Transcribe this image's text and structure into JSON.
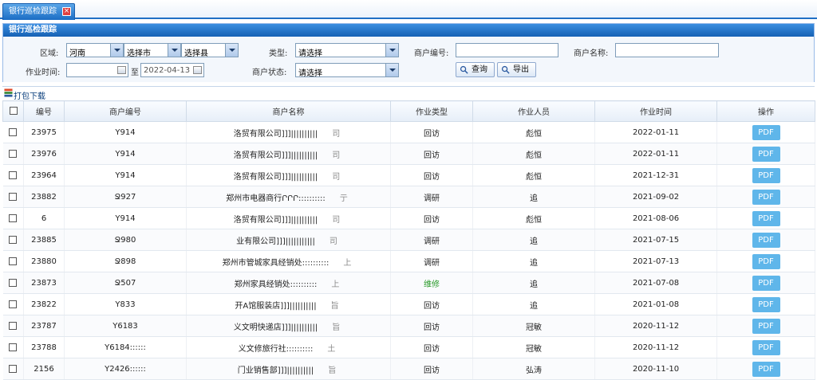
{
  "tab": {
    "title": "银行巡检跟踪"
  },
  "panel": {
    "title": "银行巡检跟踪"
  },
  "filters": {
    "region_label": "区域:",
    "province": "河南",
    "city": "选择市",
    "county": "选择县",
    "type_label": "类型:",
    "type_value": "请选择",
    "merchant_no_label": "商户编号:",
    "merchant_name_label": "商户名称:",
    "time_label": "作业时间:",
    "to_label": "至",
    "end_date": "2022-04-13",
    "status_label": "商户状态:",
    "status_value": "请选择",
    "query_label": "查询",
    "export_label": "导出"
  },
  "toolbar": {
    "download_label": "打包下载"
  },
  "table": {
    "headers": [
      "编号",
      "商户编号",
      "商户名称",
      "作业类型",
      "作业人员",
      "作业时间",
      "操作"
    ],
    "rows": [
      {
        "id": "23975",
        "merchant_no": "Y914",
        "name": "洛贸有限公司]]]||||||||||",
        "code": "司",
        "type": "回访",
        "staff": "彪恒",
        "date": "2022-01-11",
        "action": "PDF"
      },
      {
        "id": "23976",
        "merchant_no": "Y914",
        "name": "洛贸有限公司]]]||||||||||",
        "code": "司",
        "type": "回访",
        "staff": "彪恒",
        "date": "2022-01-11",
        "action": "PDF"
      },
      {
        "id": "23964",
        "merchant_no": "Y914",
        "name": "洛贸有限公司]]]||||||||||",
        "code": "司",
        "type": "回访",
        "staff": "彪恒",
        "date": "2021-12-31",
        "action": "PDF"
      },
      {
        "id": "23882",
        "merchant_no": "Ջ927",
        "name": "郑州市电器商行ՐՐՐ::::::::::",
        "code": "亍",
        "type": "调研",
        "staff": "追",
        "date": "2021-09-02",
        "action": "PDF"
      },
      {
        "id": "6",
        "merchant_no": "Y914",
        "name": "洛贸有限公司]]]||||||||||",
        "code": "司",
        "type": "回访",
        "staff": "彪恒",
        "date": "2021-08-06",
        "action": "PDF"
      },
      {
        "id": "23885",
        "merchant_no": "Ջ980",
        "name": "业有限公司]]]|||||||||||",
        "code": "司",
        "type": "调研",
        "staff": "追",
        "date": "2021-07-15",
        "action": "PDF"
      },
      {
        "id": "23880",
        "merchant_no": "Ջ898",
        "name": "郑州市管城家具经销处::::::::::",
        "code": "上",
        "type": "调研",
        "staff": "追",
        "date": "2021-07-13",
        "action": "PDF"
      },
      {
        "id": "23873",
        "merchant_no": "Ջ507",
        "name": "郑州家具经销处::::::::::",
        "code": "上",
        "type": "维修",
        "staff": "追",
        "date": "2021-07-08",
        "action": "PDF"
      },
      {
        "id": "23822",
        "merchant_no": "Y833",
        "name": "开A馆服装店]]]||||||||||",
        "code": "旨",
        "type": "回访",
        "staff": "追",
        "date": "2021-01-08",
        "action": "PDF"
      },
      {
        "id": "23787",
        "merchant_no": "Y6183",
        "name": "义文明快递店]]]||||||||||",
        "code": "旨",
        "type": "回访",
        "staff": "冠敏",
        "date": "2020-11-12",
        "action": "PDF"
      },
      {
        "id": "23788",
        "merchant_no": "Y6184::::::",
        "name": "义文修旅行社::::::::::",
        "code": "土",
        "type": "回访",
        "staff": "冠敏",
        "date": "2020-11-12",
        "action": "PDF"
      },
      {
        "id": "2156",
        "merchant_no": "Y2426::::::",
        "name": "门业销售部]]]||||||||||",
        "code": "旨",
        "type": "回访",
        "staff": "弘涛",
        "date": "2020-11-10",
        "action": "PDF"
      }
    ]
  },
  "colors": {
    "accent": "#1b6dc4",
    "pdf_button": "#5fb6ea",
    "type_highlight": "#2a9a2a"
  }
}
